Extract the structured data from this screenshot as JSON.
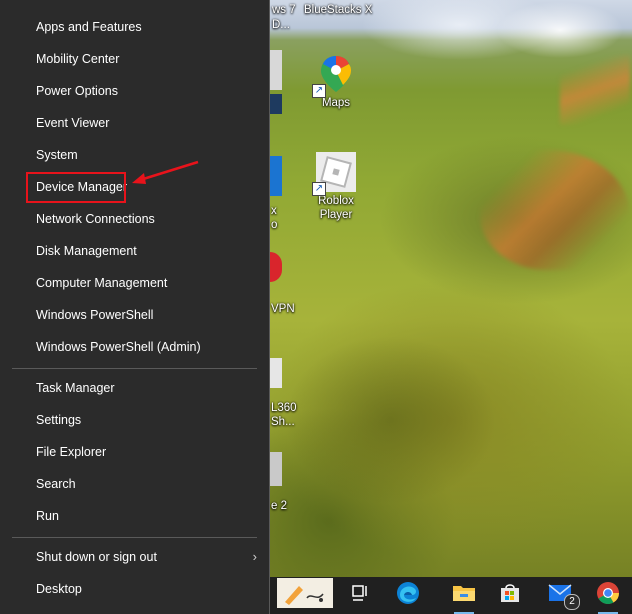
{
  "winx_menu": {
    "items": [
      {
        "label": "Apps and Features"
      },
      {
        "label": "Mobility Center"
      },
      {
        "label": "Power Options"
      },
      {
        "label": "Event Viewer"
      },
      {
        "label": "System"
      },
      {
        "label": "Device Manager"
      },
      {
        "label": "Network Connections"
      },
      {
        "label": "Disk Management"
      },
      {
        "label": "Computer Management"
      },
      {
        "label": "Windows PowerShell"
      },
      {
        "label": "Windows PowerShell (Admin)"
      },
      {
        "label": "Task Manager"
      },
      {
        "label": "Settings"
      },
      {
        "label": "File Explorer"
      },
      {
        "label": "Search"
      },
      {
        "label": "Run"
      },
      {
        "label": "Shut down or sign out"
      },
      {
        "label": "Desktop"
      }
    ],
    "highlighted_item": "Device Manager",
    "highlight_color": "#e8131b"
  },
  "desktop": {
    "top_labels": [
      "ws 7",
      "D...",
      "BlueStacks X"
    ],
    "icons": [
      {
        "label": "Maps",
        "icon": "google-maps-icon"
      },
      {
        "label_line1": "Roblox",
        "label_line2": "Player",
        "icon": "roblox-icon"
      }
    ],
    "partial_labels": [
      "x",
      "o",
      "VPN",
      "L360",
      "Sh...",
      "e 2"
    ]
  },
  "taskbar": {
    "mail_badge": "2",
    "items": [
      "paint-app-icon",
      "task-view-icon",
      "edge-icon",
      "file-explorer-icon",
      "microsoft-store-icon",
      "mail-icon",
      "chrome-icon"
    ]
  },
  "colors": {
    "menu_bg": "#2b2b2b",
    "taskbar_bg": "#202020",
    "accent": "#76b9ed"
  }
}
